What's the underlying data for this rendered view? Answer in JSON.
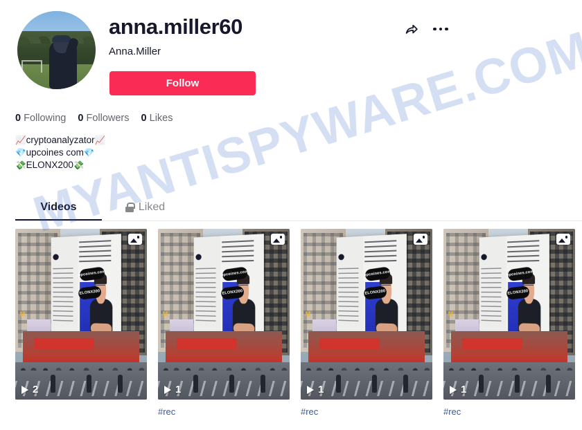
{
  "profile": {
    "username": "anna.miller60",
    "display_name": "Anna.Miller",
    "follow_label": "Follow",
    "avatar_alt": "avatar-photo"
  },
  "actions": {
    "share_icon": "share-arrow-icon",
    "more_icon": "more-options-icon"
  },
  "stats": [
    {
      "count": "0",
      "label": "Following"
    },
    {
      "count": "0",
      "label": "Followers"
    },
    {
      "count": "0",
      "label": "Likes"
    }
  ],
  "bio": {
    "line1_emoji_left": "📈",
    "line1_text": "cryptoanalyzator",
    "line1_emoji_right": "📈",
    "line2_emoji_left": "💎",
    "line2_text": "upcoines com",
    "line2_emoji_right": "💎",
    "line3_emoji_left": "💸",
    "line3_text": "ELONX200",
    "line3_emoji_right": "💸"
  },
  "tabs": [
    {
      "label": "Videos",
      "active": true,
      "icon": ""
    },
    {
      "label": "Liked",
      "active": false,
      "icon": "lock-icon"
    }
  ],
  "videos": [
    {
      "plays": "2",
      "caption": "",
      "badge": "photo-badge-icon"
    },
    {
      "plays": "1",
      "caption": "#rec",
      "badge": "photo-badge-icon"
    },
    {
      "plays": "1",
      "caption": "#rec",
      "badge": "photo-badge-icon"
    },
    {
      "plays": "1",
      "caption": "#rec",
      "badge": "photo-badge-icon"
    }
  ],
  "thumbnail_content": {
    "billboard_pill_1": "upcoines.com",
    "billboard_pill_2": "ELONX200",
    "mcdonalds_logo": "M"
  },
  "watermark": {
    "text": "MYANTISPYWARE.COM"
  },
  "colors": {
    "accent_red": "#fa2b55",
    "text_primary": "#16182b",
    "text_muted": "#65666c",
    "caption_blue": "#3b5a9b",
    "watermark_blue": "#2f5fc4"
  }
}
